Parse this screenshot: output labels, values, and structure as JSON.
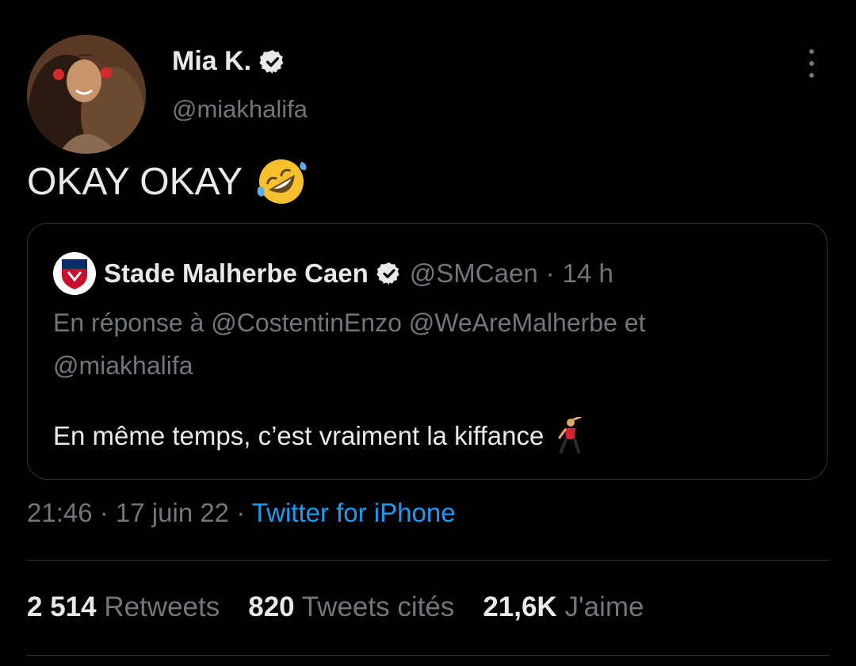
{
  "author": {
    "display_name": "Mia K.",
    "handle": "@miakhalifa",
    "verified": true
  },
  "tweet": {
    "text": "OKAY OKAY",
    "emoji": "rolling-on-floor-laughing"
  },
  "quoted_tweet": {
    "display_name": "Stade Malherbe Caen",
    "verified": true,
    "handle": "@SMCaen",
    "separator": "·",
    "time": "14 h",
    "reply_line1": "En réponse à @CostentinEnzo @WeAreMalherbe et",
    "reply_line2": "@miakhalifa",
    "text": "En même temps, c’est vraiment la kiffance",
    "emoji": "man-dancing"
  },
  "meta": {
    "time": "21:46",
    "sep1": " · ",
    "date": "17 juin 22",
    "sep2": " · ",
    "source": "Twitter for iPhone"
  },
  "stats": [
    {
      "value": "2 514",
      "label": "Retweets"
    },
    {
      "value": "820",
      "label": "Tweets cités"
    },
    {
      "value": "21,6K",
      "label": "J'aime"
    }
  ],
  "colors": {
    "background": "#000000",
    "text": "#e7e9ea",
    "secondary": "#71767b",
    "link": "#1d9bf0",
    "border": "#2f3336"
  }
}
